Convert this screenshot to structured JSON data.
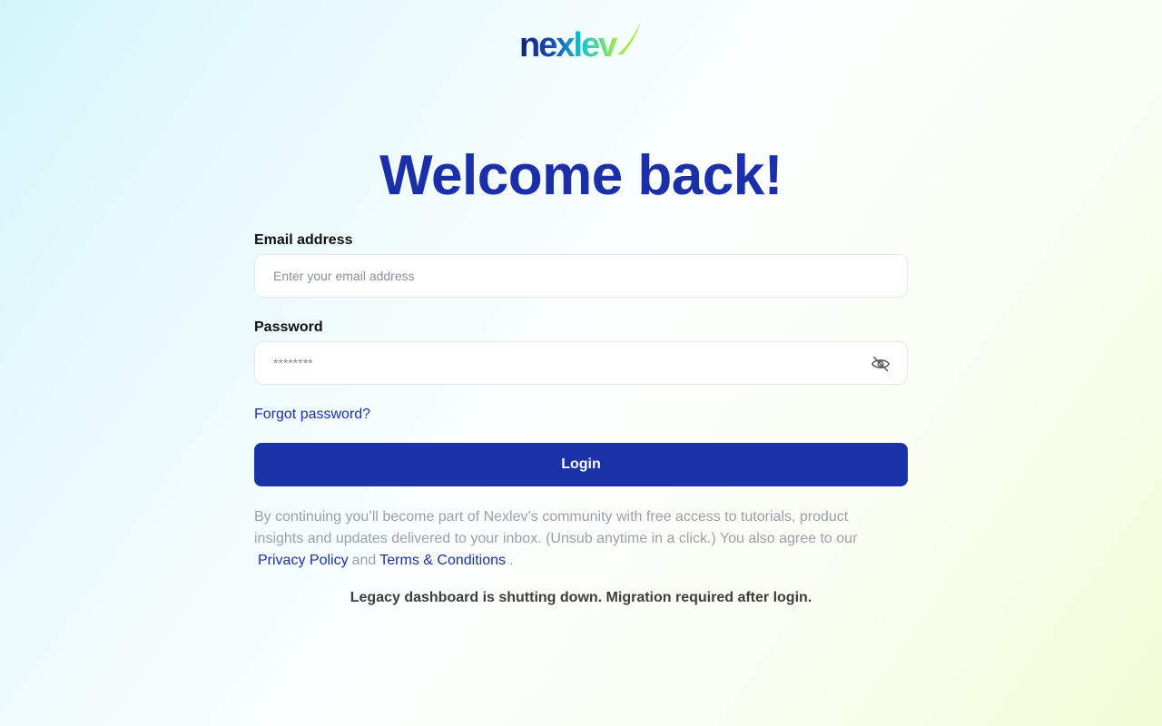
{
  "brand": {
    "logo_text": "nexlev"
  },
  "heading": "Welcome back!",
  "form": {
    "email": {
      "label": "Email address",
      "placeholder": "Enter your email address",
      "value": ""
    },
    "password": {
      "label": "Password",
      "placeholder": "********",
      "value": "",
      "toggle_icon": "eye-off-icon"
    },
    "forgot_label": "Forgot password?",
    "submit_label": "Login"
  },
  "legal": {
    "text_before": "By continuing you’ll become part of Nexlev’s community with free access to tutorials, product insights and updates delivered to your inbox. (Unsub anytime in a click.) You also agree to our",
    "privacy_label": "Privacy Policy",
    "and_text": "and",
    "terms_label": "Terms & Conditions",
    "period": "."
  },
  "notice": "Legacy dashboard is shutting down. Migration required after login.",
  "colors": {
    "primary": "#1a31a8",
    "heading": "#1a2fa8",
    "muted": "#9aa0a6",
    "logo_gradient_start": "#1a2fa8",
    "logo_gradient_end": "#a5ea4a"
  }
}
